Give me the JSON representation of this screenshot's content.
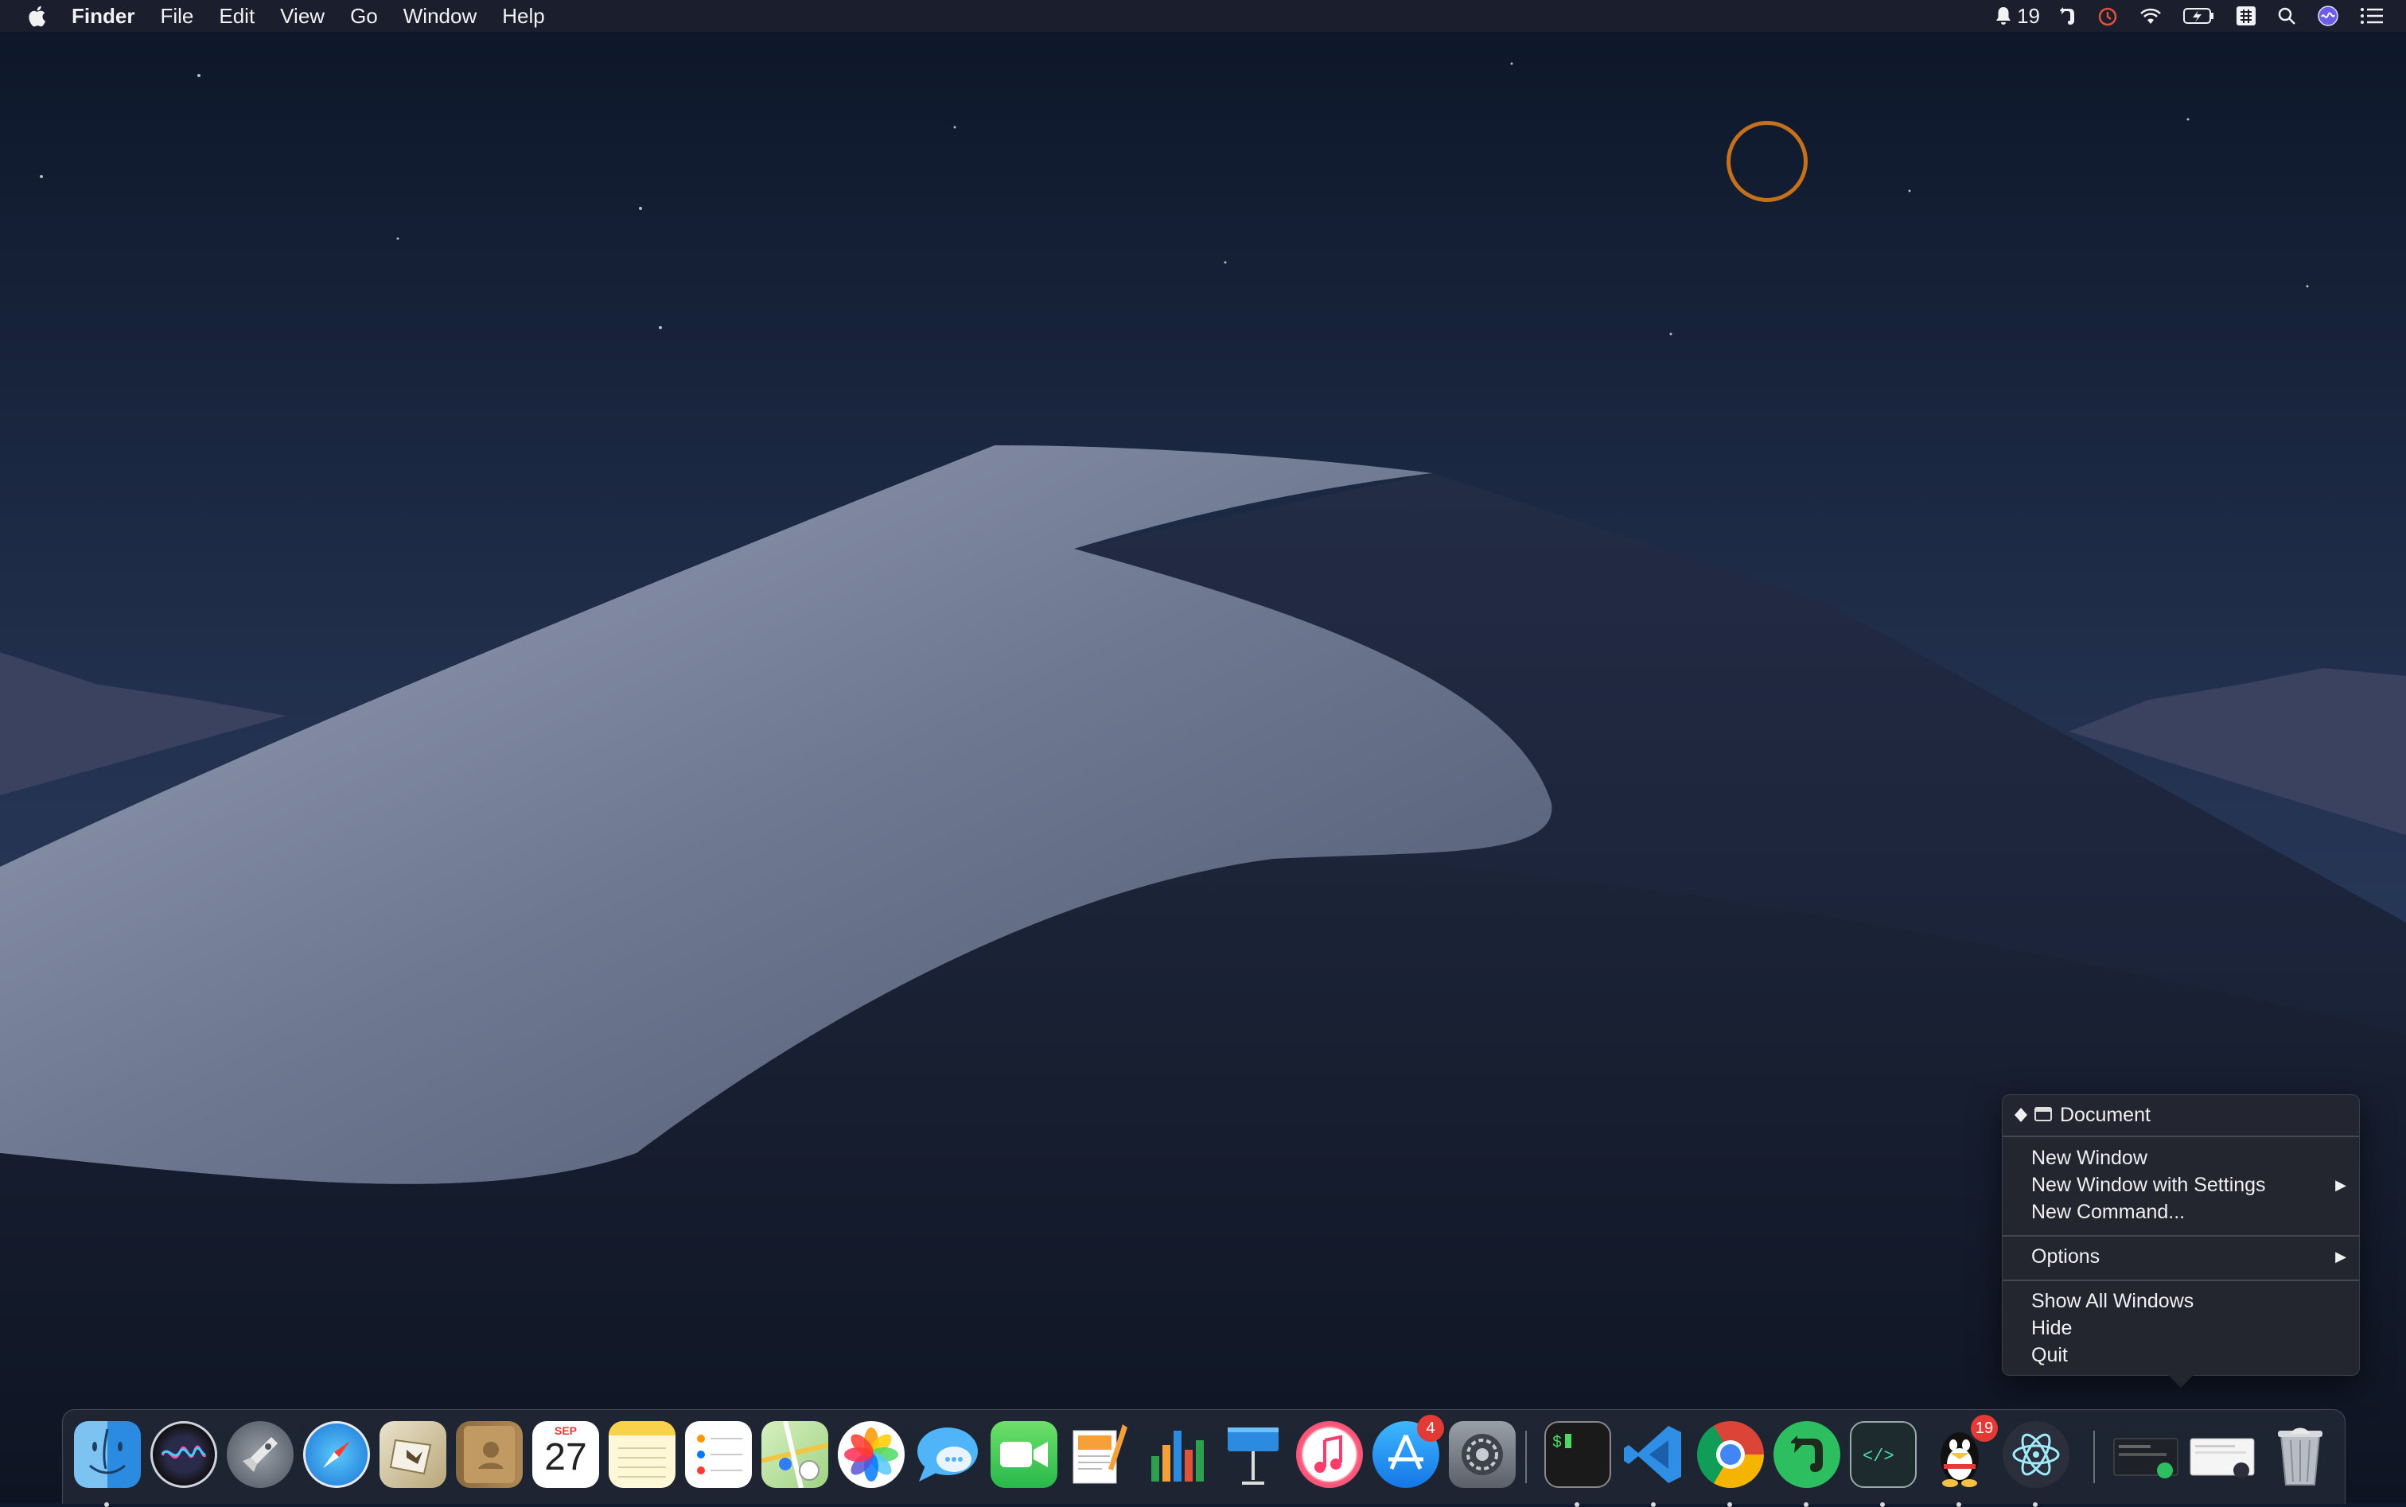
{
  "menubar": {
    "app_name": "Finder",
    "menus": [
      "File",
      "Edit",
      "View",
      "Go",
      "Window",
      "Help"
    ],
    "notification_count": "19",
    "status_icons": [
      "notification-bell-icon",
      "evernote-helper-icon",
      "timer-icon",
      "wifi-icon",
      "battery-charging-icon",
      "input-method-icon",
      "spotlight-search-icon",
      "siri-icon",
      "notification-center-icon"
    ]
  },
  "context_menu": {
    "document_label": "Document",
    "items": {
      "new_window": "New Window",
      "new_window_settings": "New Window with Settings",
      "new_command": "New Command...",
      "options": "Options",
      "show_all_windows": "Show All Windows",
      "hide": "Hide",
      "quit": "Quit"
    },
    "submenu_arrow": "▶"
  },
  "dock": {
    "items": [
      {
        "name": "Finder",
        "icon": "finder-icon"
      },
      {
        "name": "Siri",
        "icon": "siri-icon"
      },
      {
        "name": "Launchpad",
        "icon": "launchpad-icon"
      },
      {
        "name": "Safari",
        "icon": "safari-icon"
      },
      {
        "name": "Mail",
        "icon": "mail-icon"
      },
      {
        "name": "Contacts",
        "icon": "contacts-icon"
      },
      {
        "name": "Calendar",
        "icon": "calendar-icon",
        "month": "SEP",
        "day": "27"
      },
      {
        "name": "Notes",
        "icon": "notes-icon"
      },
      {
        "name": "Reminders",
        "icon": "reminders-icon"
      },
      {
        "name": "Maps",
        "icon": "maps-icon"
      },
      {
        "name": "Photos",
        "icon": "photos-icon"
      },
      {
        "name": "Messages",
        "icon": "messages-icon"
      },
      {
        "name": "FaceTime",
        "icon": "facetime-icon"
      },
      {
        "name": "Pages",
        "icon": "pages-icon"
      },
      {
        "name": "Numbers",
        "icon": "numbers-icon"
      },
      {
        "name": "Keynote",
        "icon": "keynote-icon"
      },
      {
        "name": "iTunes",
        "icon": "itunes-icon"
      },
      {
        "name": "App Store",
        "icon": "app-store-icon",
        "badge": "4"
      },
      {
        "name": "System Preferences",
        "icon": "system-preferences-icon"
      },
      {
        "name": "Terminal",
        "icon": "terminal-icon"
      },
      {
        "name": "Visual Studio Code",
        "icon": "vscode-icon"
      },
      {
        "name": "Chrome",
        "icon": "chrome-icon"
      },
      {
        "name": "Evernote",
        "icon": "evernote-icon"
      },
      {
        "name": "Script Editor",
        "icon": "code-editor-icon"
      },
      {
        "name": "QQ",
        "icon": "qq-penguin-icon",
        "badge": "19"
      },
      {
        "name": "Electron",
        "icon": "electron-atom-icon"
      },
      {
        "name": "Minimized Window 1",
        "icon": "minimized-window-icon"
      },
      {
        "name": "Minimized Window 2",
        "icon": "minimized-window-icon"
      },
      {
        "name": "Trash",
        "icon": "trash-icon"
      }
    ]
  },
  "colors": {
    "click_ring": "#c6701a",
    "badge": "#e53935",
    "menubar_bg": "#1c202c"
  }
}
